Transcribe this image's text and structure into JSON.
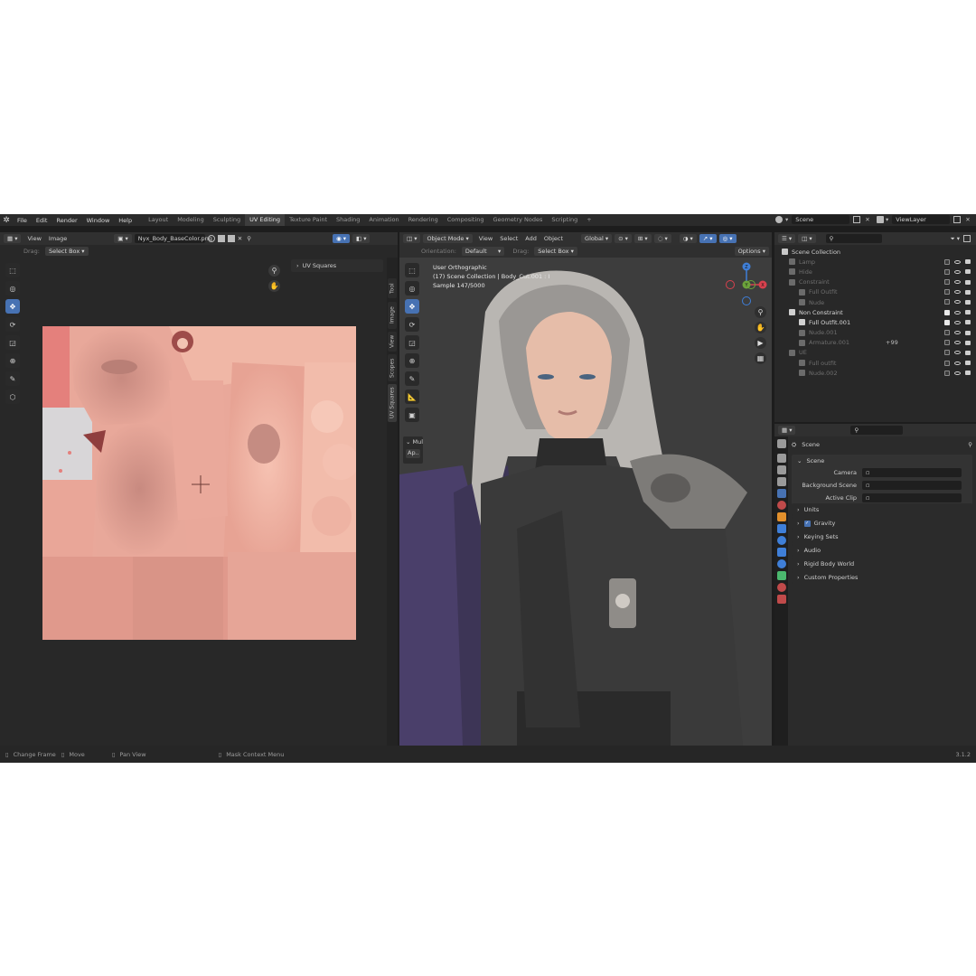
{
  "topbar": {
    "menu": [
      "File",
      "Edit",
      "Render",
      "Window",
      "Help"
    ],
    "workspaces": [
      "Layout",
      "Modeling",
      "Sculpting",
      "UV Editing",
      "Texture Paint",
      "Shading",
      "Animation",
      "Rendering",
      "Compositing",
      "Geometry Nodes",
      "Scripting"
    ],
    "active_workspace": "UV Editing",
    "add_tab": "+",
    "scene": "Scene",
    "view_layer": "ViewLayer"
  },
  "uv_editor": {
    "menu": [
      "View",
      "Image"
    ],
    "image_name": "Nyx_Body_BaseColor.png",
    "drag_label": "Drag:",
    "drag_value": "Select Box",
    "sidebar_panel": "UV Squares",
    "vertical_tabs": [
      "Tool",
      "Image",
      "View",
      "Scopes",
      "UV Squares"
    ]
  },
  "viewport": {
    "mode": "Object Mode",
    "menu": [
      "View",
      "Select",
      "Add",
      "Object"
    ],
    "transform_orientation": "Global",
    "orientation_label": "Orientation:",
    "orientation_value": "Default",
    "drag_label": "Drag:",
    "drag_value": "Select Box",
    "options": "Options",
    "overlay_line1": "User Orthographic",
    "overlay_line2": "(17) Scene Collection | Body_Cut.001 : I",
    "overlay_line3": "Sample 147/5000",
    "op_panel_title": "Mul",
    "op_panel_button": "Ap..",
    "gizmo": {
      "x": "X",
      "y": "Y",
      "z": "Z"
    }
  },
  "outliner": {
    "root": "Scene Collection",
    "items": [
      {
        "label": "Lamp",
        "depth": 0,
        "dim": true
      },
      {
        "label": "Hide",
        "depth": 0,
        "dim": true
      },
      {
        "label": "Constraint",
        "depth": 0,
        "dim": true
      },
      {
        "label": "Full Outfit",
        "depth": 1,
        "dim": true
      },
      {
        "label": "Nude",
        "depth": 1,
        "dim": true
      },
      {
        "label": "Non Constraint",
        "depth": 0,
        "dim": false
      },
      {
        "label": "Full Outfit.001",
        "depth": 1,
        "dim": false
      },
      {
        "label": "Nude.001",
        "depth": 1,
        "dim": true
      },
      {
        "label": "Armature.001",
        "depth": 1,
        "dim": true
      },
      {
        "label": "UE",
        "depth": 0,
        "dim": true
      },
      {
        "label": "Full outfit",
        "depth": 1,
        "dim": true
      },
      {
        "label": "Nude.002",
        "depth": 1,
        "dim": true
      }
    ],
    "armature_extra": "+99"
  },
  "properties": {
    "context": "Scene",
    "section": "Scene",
    "fields": [
      {
        "label": "Camera",
        "value": ""
      },
      {
        "label": "Background Scene",
        "value": ""
      },
      {
        "label": "Active Clip",
        "value": ""
      }
    ],
    "panels": [
      "Units",
      "Gravity",
      "Keying Sets",
      "Audio",
      "Rigid Body World",
      "Custom Properties"
    ],
    "gravity_enabled": true
  },
  "statusbar": {
    "items": [
      "Change Frame",
      "Move",
      "Pan View",
      "Mask Context Menu"
    ],
    "version": "3.1.2"
  },
  "colors": {
    "accent": "#4772b3",
    "skin": "#e8a498",
    "axis_x": "#d9414e",
    "axis_y": "#6ca33b",
    "axis_z": "#3f7fd8"
  }
}
